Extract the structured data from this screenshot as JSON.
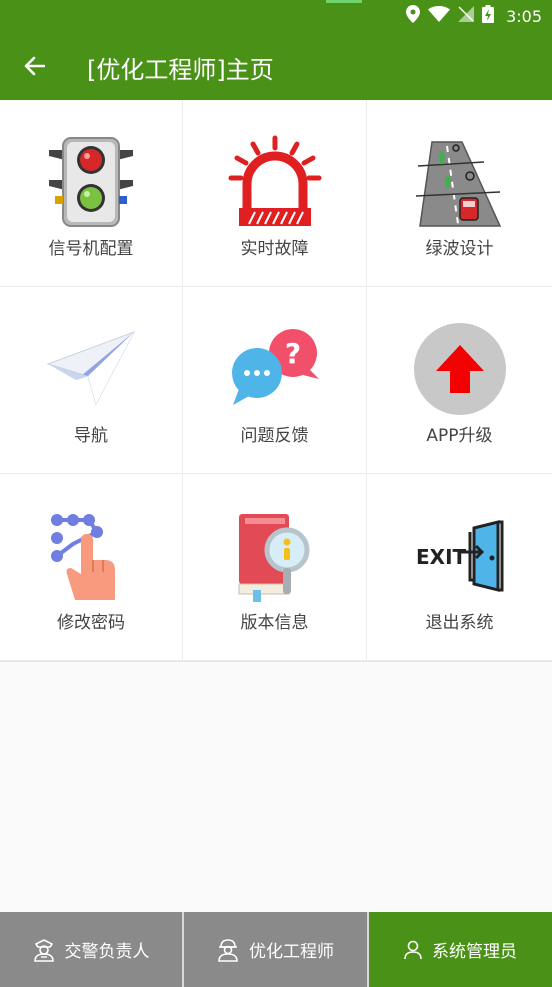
{
  "status_bar": {
    "time": "3:05",
    "icons": [
      "location-icon",
      "wifi-icon",
      "no-signal-icon",
      "battery-charging-icon"
    ]
  },
  "app_bar": {
    "title": "[优化工程师]主页",
    "back_icon": "arrow-left-icon"
  },
  "menu": {
    "items": [
      {
        "label": "信号机配置",
        "icon": "traffic-light-icon"
      },
      {
        "label": "实时故障",
        "icon": "alarm-siren-icon"
      },
      {
        "label": "绿波设计",
        "icon": "green-wave-road-icon"
      },
      {
        "label": "导航",
        "icon": "paper-plane-icon"
      },
      {
        "label": "问题反馈",
        "icon": "chat-question-icon"
      },
      {
        "label": "APP升级",
        "icon": "upgrade-arrow-icon"
      },
      {
        "label": "修改密码",
        "icon": "pattern-lock-icon"
      },
      {
        "label": "版本信息",
        "icon": "book-info-icon"
      },
      {
        "label": "退出系统",
        "icon": "exit-door-icon"
      }
    ]
  },
  "bottom_nav": {
    "items": [
      {
        "label": "交警负责人",
        "icon": "police-officer-icon",
        "active": false
      },
      {
        "label": "优化工程师",
        "icon": "engineer-icon",
        "active": false
      },
      {
        "label": "系统管理员",
        "icon": "user-icon",
        "active": true
      }
    ]
  },
  "colors": {
    "primary": "#4a9118",
    "nav_inactive": "#8a8a8a",
    "text": "#444444"
  }
}
